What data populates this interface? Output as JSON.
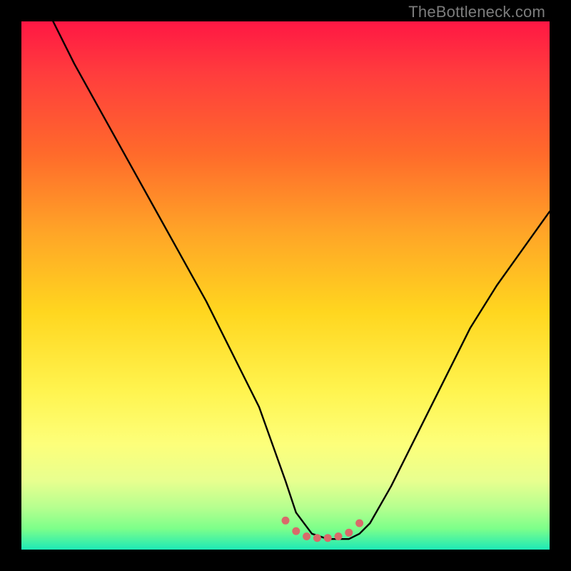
{
  "watermark": "TheBottleneck.com",
  "chart_data": {
    "type": "line",
    "title": "",
    "xlabel": "",
    "ylabel": "",
    "xlim": [
      0,
      100
    ],
    "ylim": [
      0,
      100
    ],
    "series": [
      {
        "name": "curve",
        "x": [
          6,
          10,
          15,
          20,
          25,
          30,
          35,
          40,
          45,
          50,
          52,
          55,
          58,
          60,
          62,
          64,
          66,
          70,
          75,
          80,
          85,
          90,
          95,
          100
        ],
        "y": [
          100,
          92,
          83,
          74,
          65,
          56,
          47,
          37,
          27,
          13,
          7,
          3,
          2,
          2,
          2,
          3,
          5,
          12,
          22,
          32,
          42,
          50,
          57,
          64
        ]
      }
    ],
    "markers": {
      "name": "trough-dots",
      "x": [
        50,
        52,
        54,
        56,
        58,
        60,
        62,
        64
      ],
      "y": [
        5.5,
        3.5,
        2.5,
        2.2,
        2.2,
        2.5,
        3.2,
        5.0
      ]
    },
    "gradient_note": "background encodes value: red(top)=high bottleneck, green(bottom)=no bottleneck"
  }
}
